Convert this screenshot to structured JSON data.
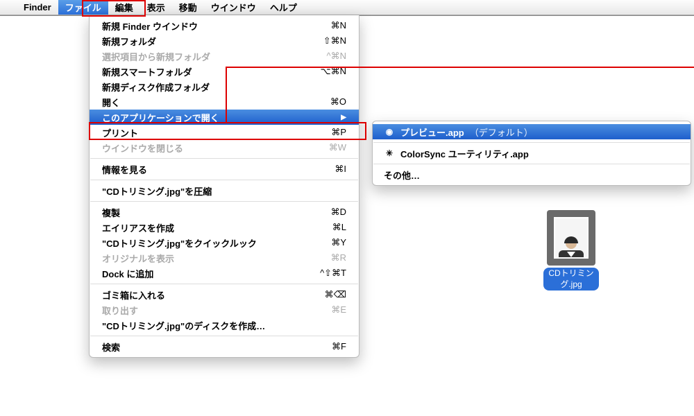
{
  "menubar": {
    "app": "Finder",
    "items": [
      "ファイル",
      "編集",
      "表示",
      "移動",
      "ウインドウ",
      "ヘルプ"
    ],
    "active_index": 0
  },
  "file_menu": [
    {
      "label": "新規 Finder ウインドウ",
      "shortcut": "⌘N",
      "disabled": false
    },
    {
      "label": "新規フォルダ",
      "shortcut": "⇧⌘N",
      "disabled": false
    },
    {
      "label": "選択項目から新規フォルダ",
      "shortcut": "^⌘N",
      "disabled": true
    },
    {
      "label": "新規スマートフォルダ",
      "shortcut": "⌥⌘N",
      "disabled": false
    },
    {
      "label": "新規ディスク作成フォルダ",
      "shortcut": "",
      "disabled": false
    },
    {
      "label": "開く",
      "shortcut": "⌘O",
      "disabled": false
    },
    {
      "label": "このアプリケーションで開く",
      "shortcut": "▶",
      "disabled": false,
      "highlighted": true,
      "submenu": true
    },
    {
      "label": "プリント",
      "shortcut": "⌘P",
      "disabled": false
    },
    {
      "label": "ウインドウを閉じる",
      "shortcut": "⌘W",
      "disabled": true
    },
    {
      "sep": true
    },
    {
      "label": "情報を見る",
      "shortcut": "⌘I",
      "disabled": false
    },
    {
      "sep": true
    },
    {
      "label": "\"CDトリミング.jpg\"を圧縮",
      "shortcut": "",
      "disabled": false
    },
    {
      "sep": true
    },
    {
      "label": "複製",
      "shortcut": "⌘D",
      "disabled": false
    },
    {
      "label": "エイリアスを作成",
      "shortcut": "⌘L",
      "disabled": false
    },
    {
      "label": "\"CDトリミング.jpg\"をクイックルック",
      "shortcut": "⌘Y",
      "disabled": false
    },
    {
      "label": "オリジナルを表示",
      "shortcut": "⌘R",
      "disabled": true
    },
    {
      "label": "Dock に追加",
      "shortcut": "^⇧⌘T",
      "disabled": false
    },
    {
      "sep": true
    },
    {
      "label": "ゴミ箱に入れる",
      "shortcut": "⌘⌫",
      "disabled": false
    },
    {
      "label": "取り出す",
      "shortcut": "⌘E",
      "disabled": true
    },
    {
      "label": "\"CDトリミング.jpg\"のディスクを作成…",
      "shortcut": "",
      "disabled": false
    },
    {
      "sep": true
    },
    {
      "label": "検索",
      "shortcut": "⌘F",
      "disabled": false
    }
  ],
  "open_with_submenu": {
    "default_app": {
      "name": "プレビュー.app",
      "suffix": "（デフォルト）"
    },
    "other_apps": [
      {
        "name": "ColorSync ユーティリティ.app"
      }
    ],
    "other_label": "その他…"
  },
  "desktop_file": {
    "filename": "CDトリミング.jpg"
  }
}
